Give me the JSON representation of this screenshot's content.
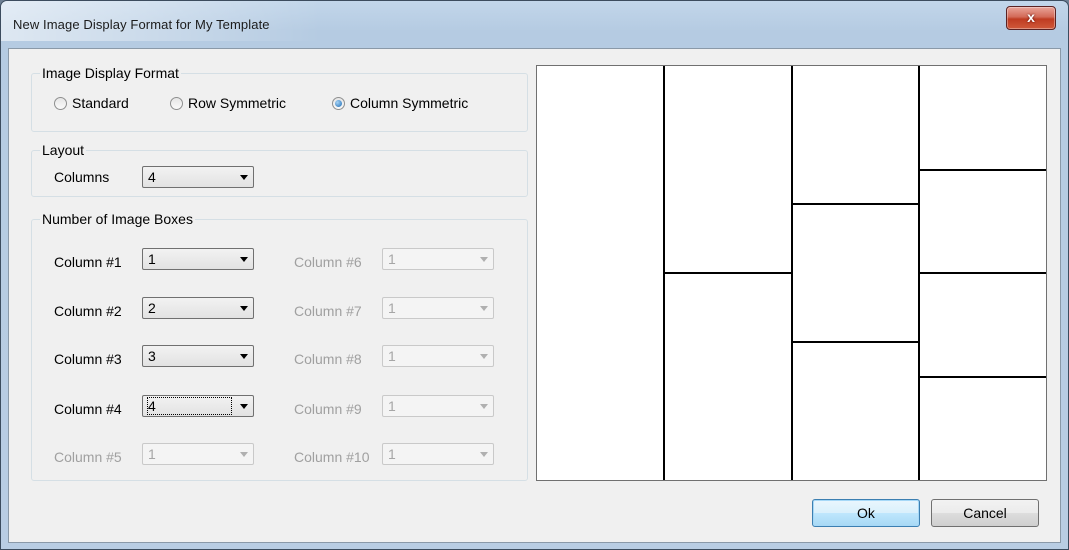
{
  "window": {
    "title": "New Image Display Format for My Template",
    "close_symbol": "x"
  },
  "display_format": {
    "title": "Image Display Format",
    "options": [
      {
        "label": "Standard",
        "checked": false
      },
      {
        "label": "Row Symmetric",
        "checked": false
      },
      {
        "label": "Column Symmetric",
        "checked": true
      }
    ]
  },
  "layout": {
    "title": "Layout",
    "columns_label": "Columns",
    "columns_value": "4"
  },
  "image_boxes": {
    "title": "Number of Image Boxes",
    "columns": [
      {
        "label": "Column #1",
        "value": "1",
        "enabled": true
      },
      {
        "label": "Column #2",
        "value": "2",
        "enabled": true
      },
      {
        "label": "Column #3",
        "value": "3",
        "enabled": true
      },
      {
        "label": "Column #4",
        "value": "4",
        "enabled": true,
        "focused": true
      },
      {
        "label": "Column #5",
        "value": "1",
        "enabled": false
      },
      {
        "label": "Column #6",
        "value": "1",
        "enabled": false
      },
      {
        "label": "Column #7",
        "value": "1",
        "enabled": false
      },
      {
        "label": "Column #8",
        "value": "1",
        "enabled": false
      },
      {
        "label": "Column #9",
        "value": "1",
        "enabled": false
      },
      {
        "label": "Column #10",
        "value": "1",
        "enabled": false
      }
    ]
  },
  "preview": {
    "column_box_counts": [
      1,
      2,
      3,
      4
    ]
  },
  "buttons": {
    "ok": "Ok",
    "cancel": "Cancel"
  }
}
